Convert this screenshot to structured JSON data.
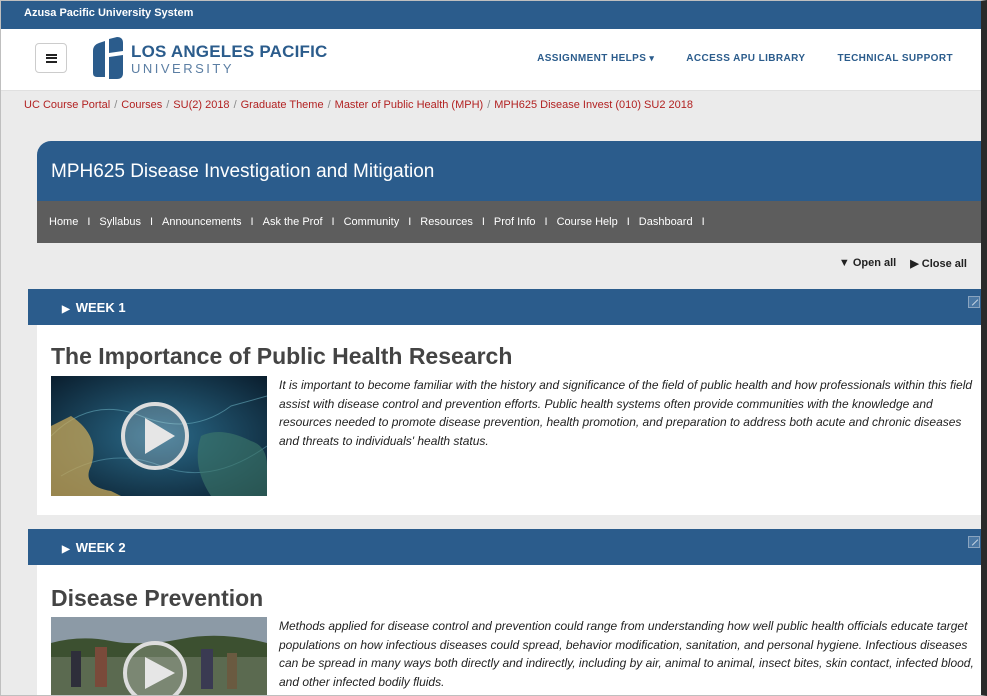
{
  "system_bar": "Azusa Pacific University System",
  "logo": {
    "line1": "LOS ANGELES PACIFIC",
    "line2": "UNIVERSITY"
  },
  "topnav": [
    {
      "label": "ASSIGNMENT HELPS",
      "dropdown": true
    },
    {
      "label": "ACCESS APU LIBRARY",
      "dropdown": false
    },
    {
      "label": "TECHNICAL SUPPORT",
      "dropdown": false
    }
  ],
  "breadcrumb": [
    "UC Course Portal",
    "Courses",
    "SU(2) 2018",
    "Graduate Theme",
    "Master of Public Health (MPH)",
    "MPH625 Disease Invest (010) SU2 2018"
  ],
  "course": {
    "title": "MPH625 Disease Investigation and Mitigation",
    "nav": [
      "Home",
      "Syllabus",
      "Announcements",
      "Ask the Prof",
      "Community",
      "Resources",
      "Prof Info",
      "Course Help",
      "Dashboard"
    ]
  },
  "controls": {
    "open_all": "Open all",
    "close_all": "Close all"
  },
  "weeks": [
    {
      "label": "WEEK 1",
      "title": "The Importance of Public Health Research",
      "description": "It is important to become familiar with the history and significance of the field of public health and how professionals within this field assist with disease control and prevention efforts. Public health systems often provide communities with the knowledge and resources needed to promote disease prevention, health promotion, and preparation to address both acute and chronic diseases and threats to individuals' health status."
    },
    {
      "label": "WEEK 2",
      "title": "Disease Prevention",
      "description": "Methods applied for disease control and prevention could range from understanding how well public health officials educate target populations on how infectious diseases could spread, behavior modification, sanitation, and personal hygiene. Infectious diseases can be spread in many ways both directly and indirectly, including by air, animal to animal, insect bites, skin contact, infected blood, and other infected bodily fluids."
    }
  ],
  "colors": {
    "brand_blue": "#2b5c8c",
    "nav_gray": "#5d5d5d",
    "breadcrumb_red": "#b22222"
  },
  "icons": {
    "menu": "hamburger-icon",
    "play": "play-icon",
    "expand": "expand-icon"
  }
}
